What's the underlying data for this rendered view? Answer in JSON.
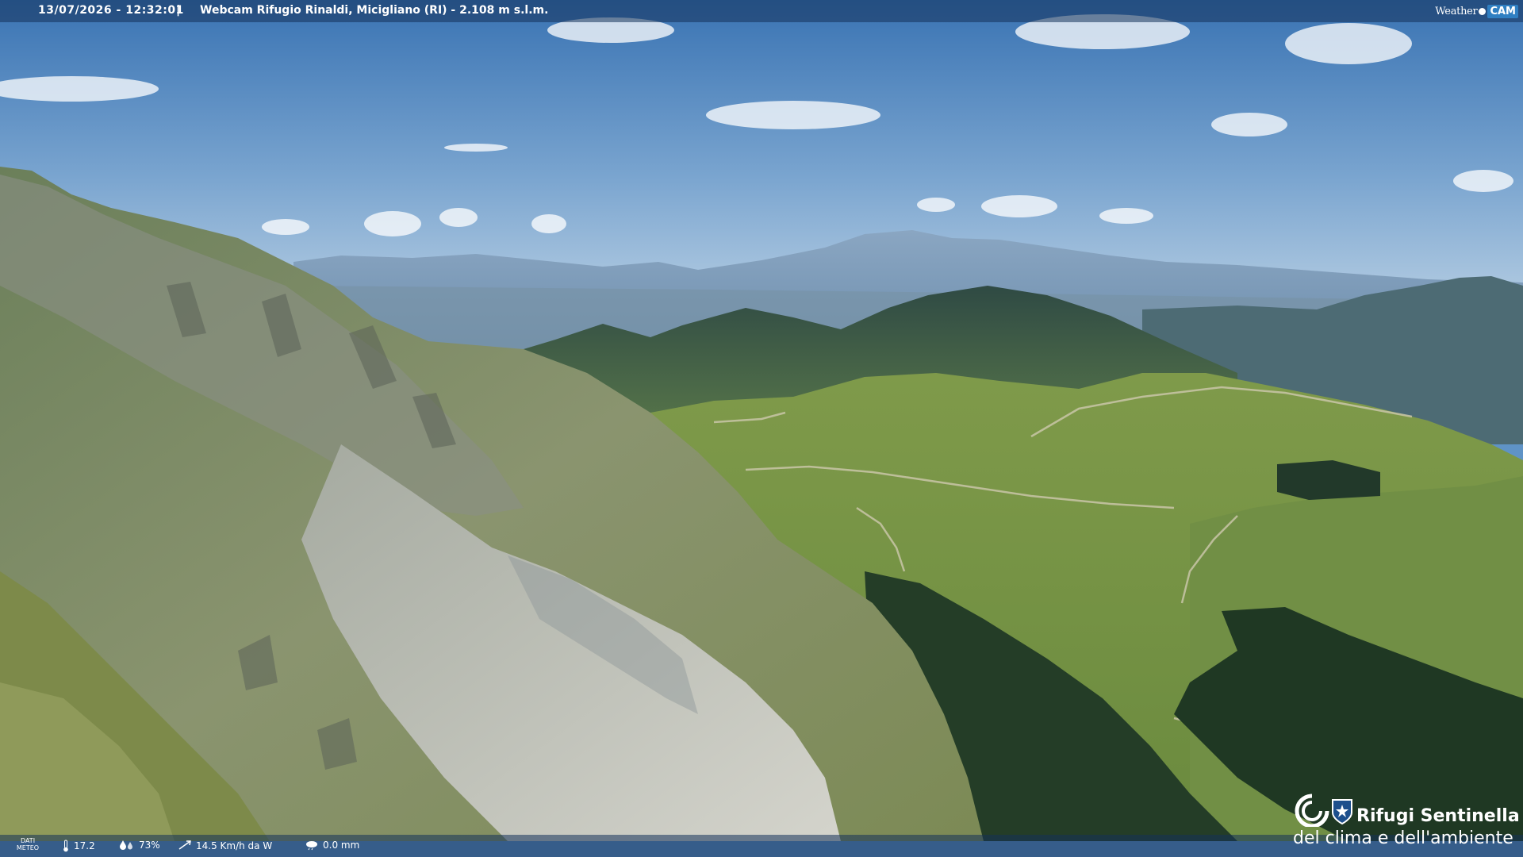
{
  "overlay": {
    "timestamp": "13/07/2026 - 12:32:01",
    "separator": "|",
    "title": "Webcam Rifugio Rinaldi, Micigliano (RI) - 2.108 m s.l.m.",
    "logo_weather": "Weather",
    "logo_cam": "CAM"
  },
  "meteo": {
    "label_line1": "DATI",
    "label_line2": "METEO",
    "temperature": "17.2",
    "humidity": "73%",
    "wind": "14.5 Km/h da W",
    "rain": "0.0 mm"
  },
  "brand": {
    "line1": "Rifugi Sentinella",
    "line2": "del clima e dell'ambiente"
  },
  "icons": {
    "thermometer": "thermometer-icon",
    "humidity": "humidity-icon",
    "wind": "wind-icon",
    "rain": "rain-icon",
    "brand_emblem": "cai-emblem-icon",
    "brand_shield": "shield-icon"
  },
  "colors": {
    "sky_top": "#3d79b8",
    "sky_bottom": "#a9c8e0",
    "grass": "#6f8a3e",
    "scree": "#c9c9c1",
    "forest": "#1f3a24",
    "overlay_bar": "#14325a"
  }
}
